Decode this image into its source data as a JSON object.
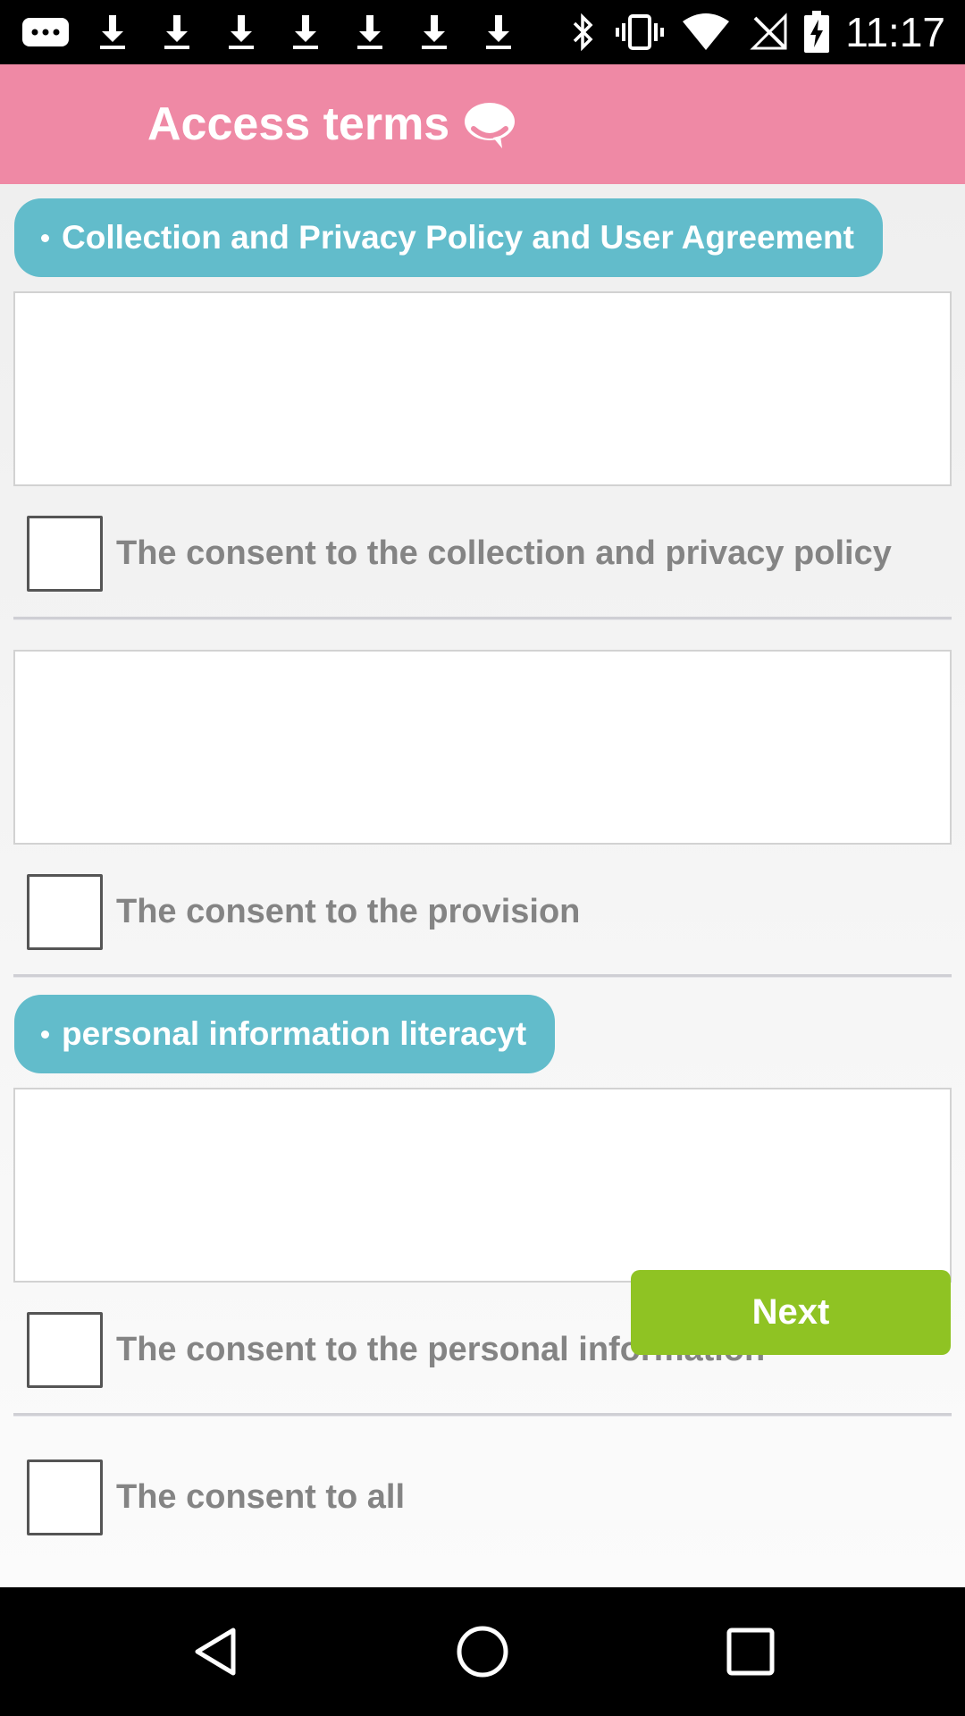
{
  "status_bar": {
    "time": "11:17",
    "icons": [
      "messaging-icon",
      "download-icon",
      "download-icon",
      "download-icon",
      "download-icon",
      "download-icon",
      "download-icon",
      "download-icon",
      "bluetooth-icon",
      "vibrate-icon",
      "wifi-icon",
      "no-signal-icon",
      "battery-charging-icon"
    ]
  },
  "app_bar": {
    "title": "Access terms",
    "icon": "chat-bubble-icon"
  },
  "sections": [
    {
      "title": "Collection and Privacy Policy and User Agreement"
    },
    {
      "title": "personal information literacyt"
    }
  ],
  "consents": {
    "collection_privacy": "The consent to the collection and privacy policy",
    "provision": "The consent to the provision",
    "personal_information": "The consent to the personal information",
    "all": "The consent to all"
  },
  "actions": {
    "next_label": "Next"
  },
  "colors": {
    "app_bar": "#ef89a5",
    "section_pill": "#62bccb",
    "next_button": "#8fc323",
    "consent_text": "#848484"
  },
  "nav_bar": {
    "icons": [
      "back-icon",
      "home-icon",
      "recents-icon"
    ]
  }
}
